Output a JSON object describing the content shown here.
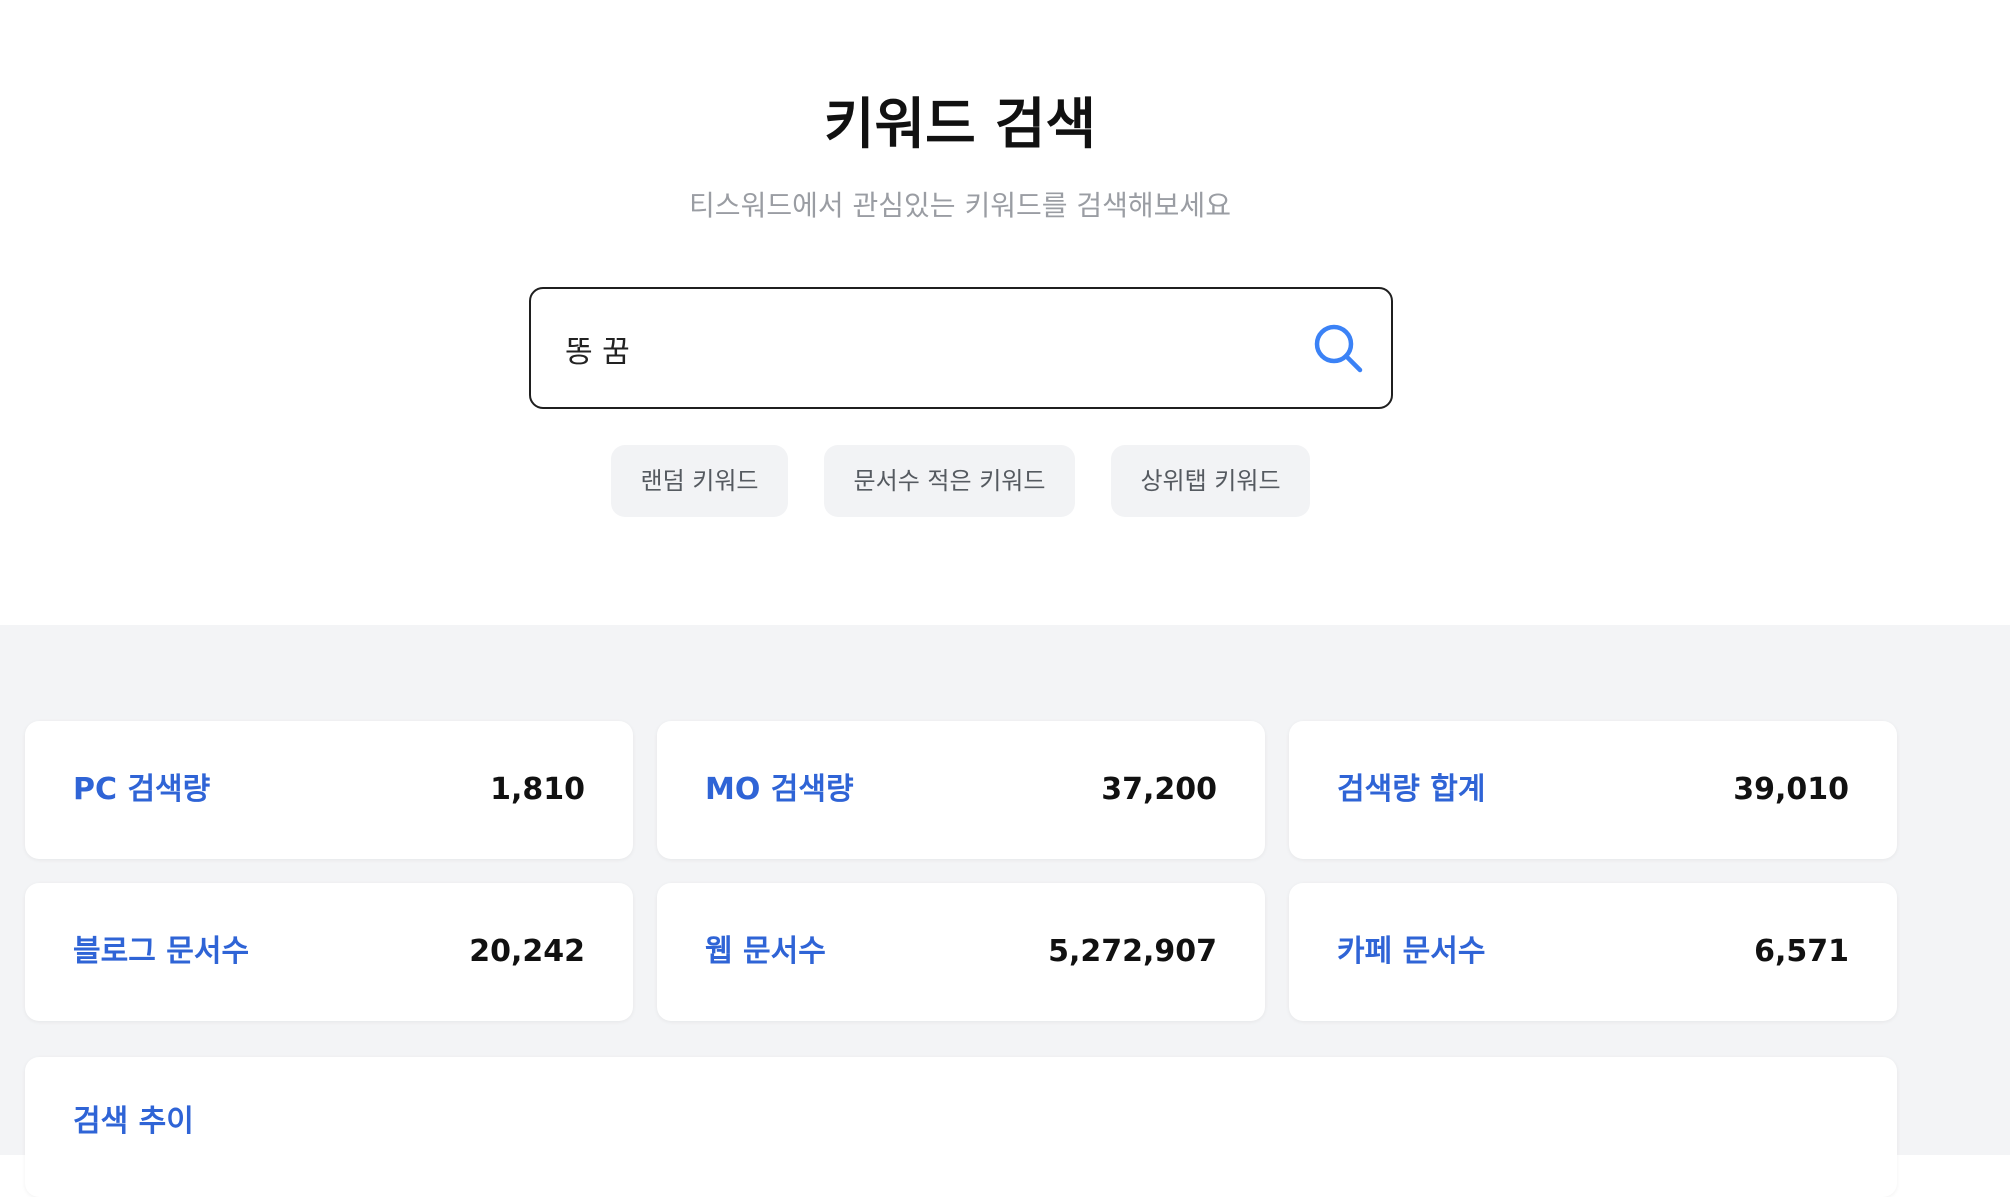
{
  "header": {
    "title": "키워드 검색",
    "subtitle": "티스워드에서 관심있는 키워드를 검색해보세요"
  },
  "search": {
    "value": "똥 꿈",
    "icon": "search-icon"
  },
  "quick_buttons": [
    {
      "label": "랜덤 키워드"
    },
    {
      "label": "문서수 적은 키워드"
    },
    {
      "label": "상위탭 키워드"
    }
  ],
  "stats": [
    {
      "label": "PC 검색량",
      "value": "1,810"
    },
    {
      "label": "MO 검색량",
      "value": "37,200"
    },
    {
      "label": "검색량 합계",
      "value": "39,010"
    },
    {
      "label": "블로그 문서수",
      "value": "20,242"
    },
    {
      "label": "웹 문서수",
      "value": "5,272,907"
    },
    {
      "label": "카페 문서수",
      "value": "6,571"
    }
  ],
  "trend": {
    "title": "검색 추이"
  },
  "colors": {
    "accent": "#2f64d6",
    "icon": "#3b82f6",
    "background_secondary": "#f3f4f6"
  }
}
